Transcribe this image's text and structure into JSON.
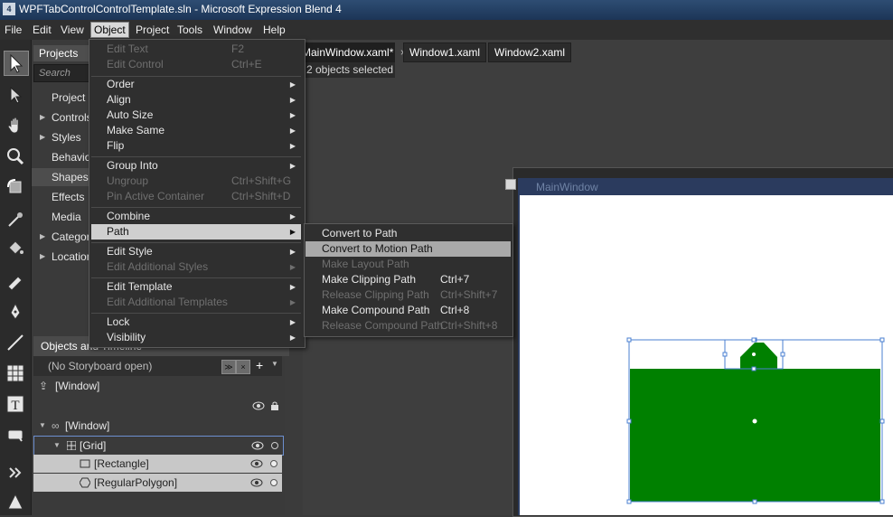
{
  "window": {
    "title": "WPFTabControlControlTemplate.sln - Microsoft Expression Blend 4",
    "icon_label": "4"
  },
  "menubar": [
    "File",
    "Edit",
    "View",
    "Object",
    "Project",
    "Tools",
    "Window",
    "Help"
  ],
  "projects_panel": {
    "tab": "Projects",
    "search_placeholder": "Search",
    "items": [
      {
        "label": "Project",
        "arrow": false,
        "selected": false
      },
      {
        "label": "Controls",
        "arrow": true,
        "selected": false
      },
      {
        "label": "Styles",
        "arrow": true,
        "selected": false
      },
      {
        "label": "Behavio",
        "arrow": false,
        "selected": false
      },
      {
        "label": "Shapes",
        "arrow": false,
        "selected": true
      },
      {
        "label": "Effects",
        "arrow": false,
        "selected": false
      },
      {
        "label": "Media",
        "arrow": false,
        "selected": false
      },
      {
        "label": "Categor",
        "arrow": true,
        "selected": false
      },
      {
        "label": "Location",
        "arrow": true,
        "selected": false
      }
    ]
  },
  "objects_panel": {
    "header": "Objects and Timeline",
    "storyboard": "(No Storyboard open)",
    "rows": {
      "window_resource": "[Window]",
      "window": "[Window]",
      "grid": "[Grid]",
      "rectangle": "[Rectangle]",
      "polygon": "[RegularPolygon]"
    }
  },
  "document": {
    "tabs": [
      "MainWindow.xaml*",
      "Window1.xaml",
      "Window2.xaml"
    ],
    "tab_close": "×",
    "status": "2 objects selected",
    "artboard_caption": "MainWindow",
    "shape_color": "#008000"
  },
  "object_menu": [
    {
      "label": "Edit Text",
      "shortcut": "F2",
      "enabled": false,
      "submenu": false
    },
    {
      "label": "Edit Control",
      "shortcut": "Ctrl+E",
      "enabled": false,
      "submenu": false
    },
    {
      "sep": true
    },
    {
      "label": "Order",
      "enabled": true,
      "submenu": true
    },
    {
      "label": "Align",
      "enabled": true,
      "submenu": true
    },
    {
      "label": "Auto Size",
      "enabled": true,
      "submenu": true
    },
    {
      "label": "Make Same",
      "enabled": true,
      "submenu": true
    },
    {
      "label": "Flip",
      "enabled": true,
      "submenu": true
    },
    {
      "sep": true
    },
    {
      "label": "Group Into",
      "enabled": true,
      "submenu": true
    },
    {
      "label": "Ungroup",
      "shortcut": "Ctrl+Shift+G",
      "enabled": false,
      "submenu": false
    },
    {
      "label": "Pin Active Container",
      "shortcut": "Ctrl+Shift+D",
      "enabled": false,
      "submenu": false
    },
    {
      "sep": true
    },
    {
      "label": "Combine",
      "enabled": true,
      "submenu": true
    },
    {
      "label": "Path",
      "enabled": true,
      "submenu": true,
      "highlight": true
    },
    {
      "sep": true
    },
    {
      "label": "Edit Style",
      "enabled": true,
      "submenu": true
    },
    {
      "label": "Edit Additional Styles",
      "enabled": false,
      "submenu": true
    },
    {
      "sep": true
    },
    {
      "label": "Edit Template",
      "enabled": true,
      "submenu": true
    },
    {
      "label": "Edit Additional Templates",
      "enabled": false,
      "submenu": true
    },
    {
      "sep": true
    },
    {
      "label": "Lock",
      "enabled": true,
      "submenu": true
    },
    {
      "label": "Visibility",
      "enabled": true,
      "submenu": true
    }
  ],
  "path_menu": [
    {
      "label": "Convert to Path",
      "shortcut": "",
      "enabled": true
    },
    {
      "label": "Convert to Motion Path",
      "shortcut": "",
      "enabled": true,
      "highlight": true
    },
    {
      "label": "Make Layout Path",
      "shortcut": "",
      "enabled": false
    },
    {
      "label": "Make Clipping Path",
      "shortcut": "Ctrl+7",
      "enabled": true
    },
    {
      "label": "Release Clipping Path",
      "shortcut": "Ctrl+Shift+7",
      "enabled": false
    },
    {
      "label": "Make Compound Path",
      "shortcut": "Ctrl+8",
      "enabled": true
    },
    {
      "label": "Release Compound Path",
      "shortcut": "Ctrl+Shift+8",
      "enabled": false
    }
  ]
}
